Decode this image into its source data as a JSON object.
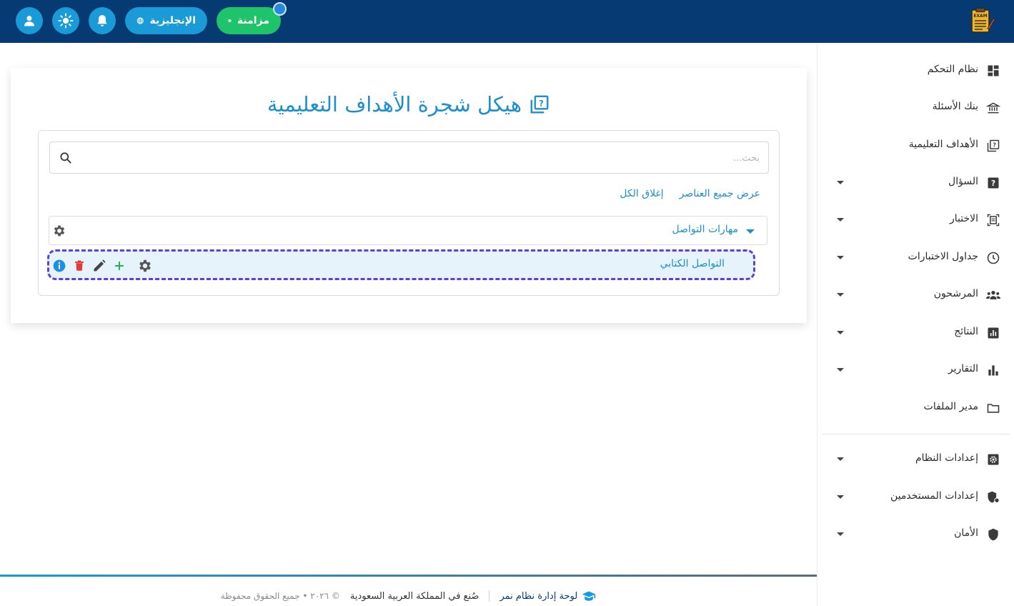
{
  "topbar": {
    "sync_label": "مزامنة",
    "language_label": "الإنجليزية",
    "logo_text": "EXAM"
  },
  "sidebar": {
    "items": [
      {
        "label": "نظام التحكم",
        "icon": "dashboard-icon"
      },
      {
        "label": "بنك الأسئلة",
        "icon": "bank-icon"
      },
      {
        "label": "الأهداف التعليمية",
        "icon": "objectives-icon"
      },
      {
        "label": "السؤال",
        "icon": "question-icon"
      },
      {
        "label": "الاختبار",
        "icon": "exam-icon"
      },
      {
        "label": "جداول الاختبارات",
        "icon": "clock-icon"
      },
      {
        "label": "المرشحون",
        "icon": "people-icon"
      },
      {
        "label": "النتائج",
        "icon": "results-icon"
      },
      {
        "label": "التقارير",
        "icon": "bar-chart-icon"
      },
      {
        "label": "مدير الملفات",
        "icon": "folder-icon"
      },
      {
        "label": "إعدادات النظام",
        "icon": "settings-icon"
      },
      {
        "label": "إعدادات المستخدمين",
        "icon": "user-shield-icon"
      },
      {
        "label": "الأمان",
        "icon": "shield-icon"
      }
    ]
  },
  "main": {
    "title": "هيكل شجرة الأهداف التعليمية",
    "search_placeholder": "بحث...",
    "show_all": "عرض جميع العناصر",
    "close_all": "إغلاق الكل",
    "tree": {
      "node_label": "مهارات التواصل",
      "child_label": "التواصل الكتابي"
    }
  },
  "footer": {
    "brand": "لوحة إدارة نظام نمر",
    "made_in": "صُنع في المملكة العربية السعودية",
    "copyright": "© ٢٠٢٦ • جميع الحقوق محفوظة"
  },
  "colors": {
    "topbar": "#063a73",
    "accent": "#1a9bd7",
    "sync": "#1fc36a",
    "highlight_border": "#5b42d6"
  }
}
